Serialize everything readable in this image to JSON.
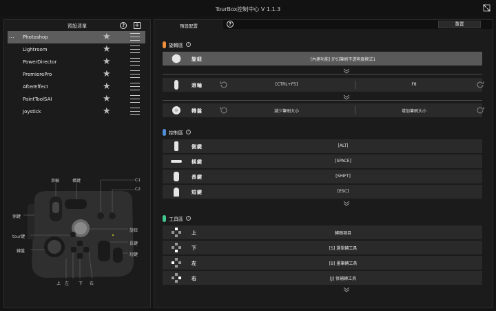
{
  "window": {
    "title": "TourBox控制中心 V 1.1.3"
  },
  "left_panel": {
    "title": "預設清單",
    "selected_dots": "...",
    "presets": [
      {
        "name": "Photoshop",
        "selected": true
      },
      {
        "name": "Lightroom",
        "selected": false
      },
      {
        "name": "PowerDirector",
        "selected": false
      },
      {
        "name": "PremierePro",
        "selected": false
      },
      {
        "name": "AfterEffect",
        "selected": false
      },
      {
        "name": "PaintToolSAI",
        "selected": false
      },
      {
        "name": "Joystick",
        "selected": false
      }
    ],
    "device_labels": {
      "knob": "滾輪",
      "tall": "橫鍵",
      "c1": "C1",
      "c2": "C2",
      "side": "側鍵",
      "dial": "旋鈕",
      "tour": "tour鍵",
      "long": "長鍵",
      "scroll": "轉盤",
      "short": "短鍵",
      "up": "上",
      "left": "左",
      "down": "下",
      "right": "右"
    }
  },
  "right_panel": {
    "tab_label": "預設配置",
    "reset_label": "重置",
    "sections": {
      "rotary": {
        "title": "旋轉區",
        "color": "#f0903a"
      },
      "control": {
        "title": "控制區",
        "color": "#4f8fd8"
      },
      "tools": {
        "title": "工具區",
        "color": "#3ec98e"
      }
    },
    "rotary_rows": {
      "knob": {
        "label": "旋鈕",
        "value": "[內建功能] [PS]筆刷不透明度模式1"
      },
      "scroll": {
        "label": "滾輪",
        "left": "[CTRL+F5]",
        "right": "F8"
      },
      "dial": {
        "label": "轉盤",
        "left": "減少筆刷大小",
        "right": "增加筆刷大小"
      }
    },
    "control_rows": [
      {
        "label": "側鍵",
        "value": "[ALT]"
      },
      {
        "label": "橫鍵",
        "value": "[SPACE]"
      },
      {
        "label": "長鍵",
        "value": "[SHIFT]"
      },
      {
        "label": "短鍵",
        "value": "[ESC]"
      }
    ],
    "tool_rows": [
      {
        "label": "上",
        "value": "轉踏項目"
      },
      {
        "label": "下",
        "value": "[S] 選單轉工具"
      },
      {
        "label": "左",
        "value": "[B] 畫筆轉工具"
      },
      {
        "label": "右",
        "value": "[J] 修補轉工具"
      }
    ]
  }
}
